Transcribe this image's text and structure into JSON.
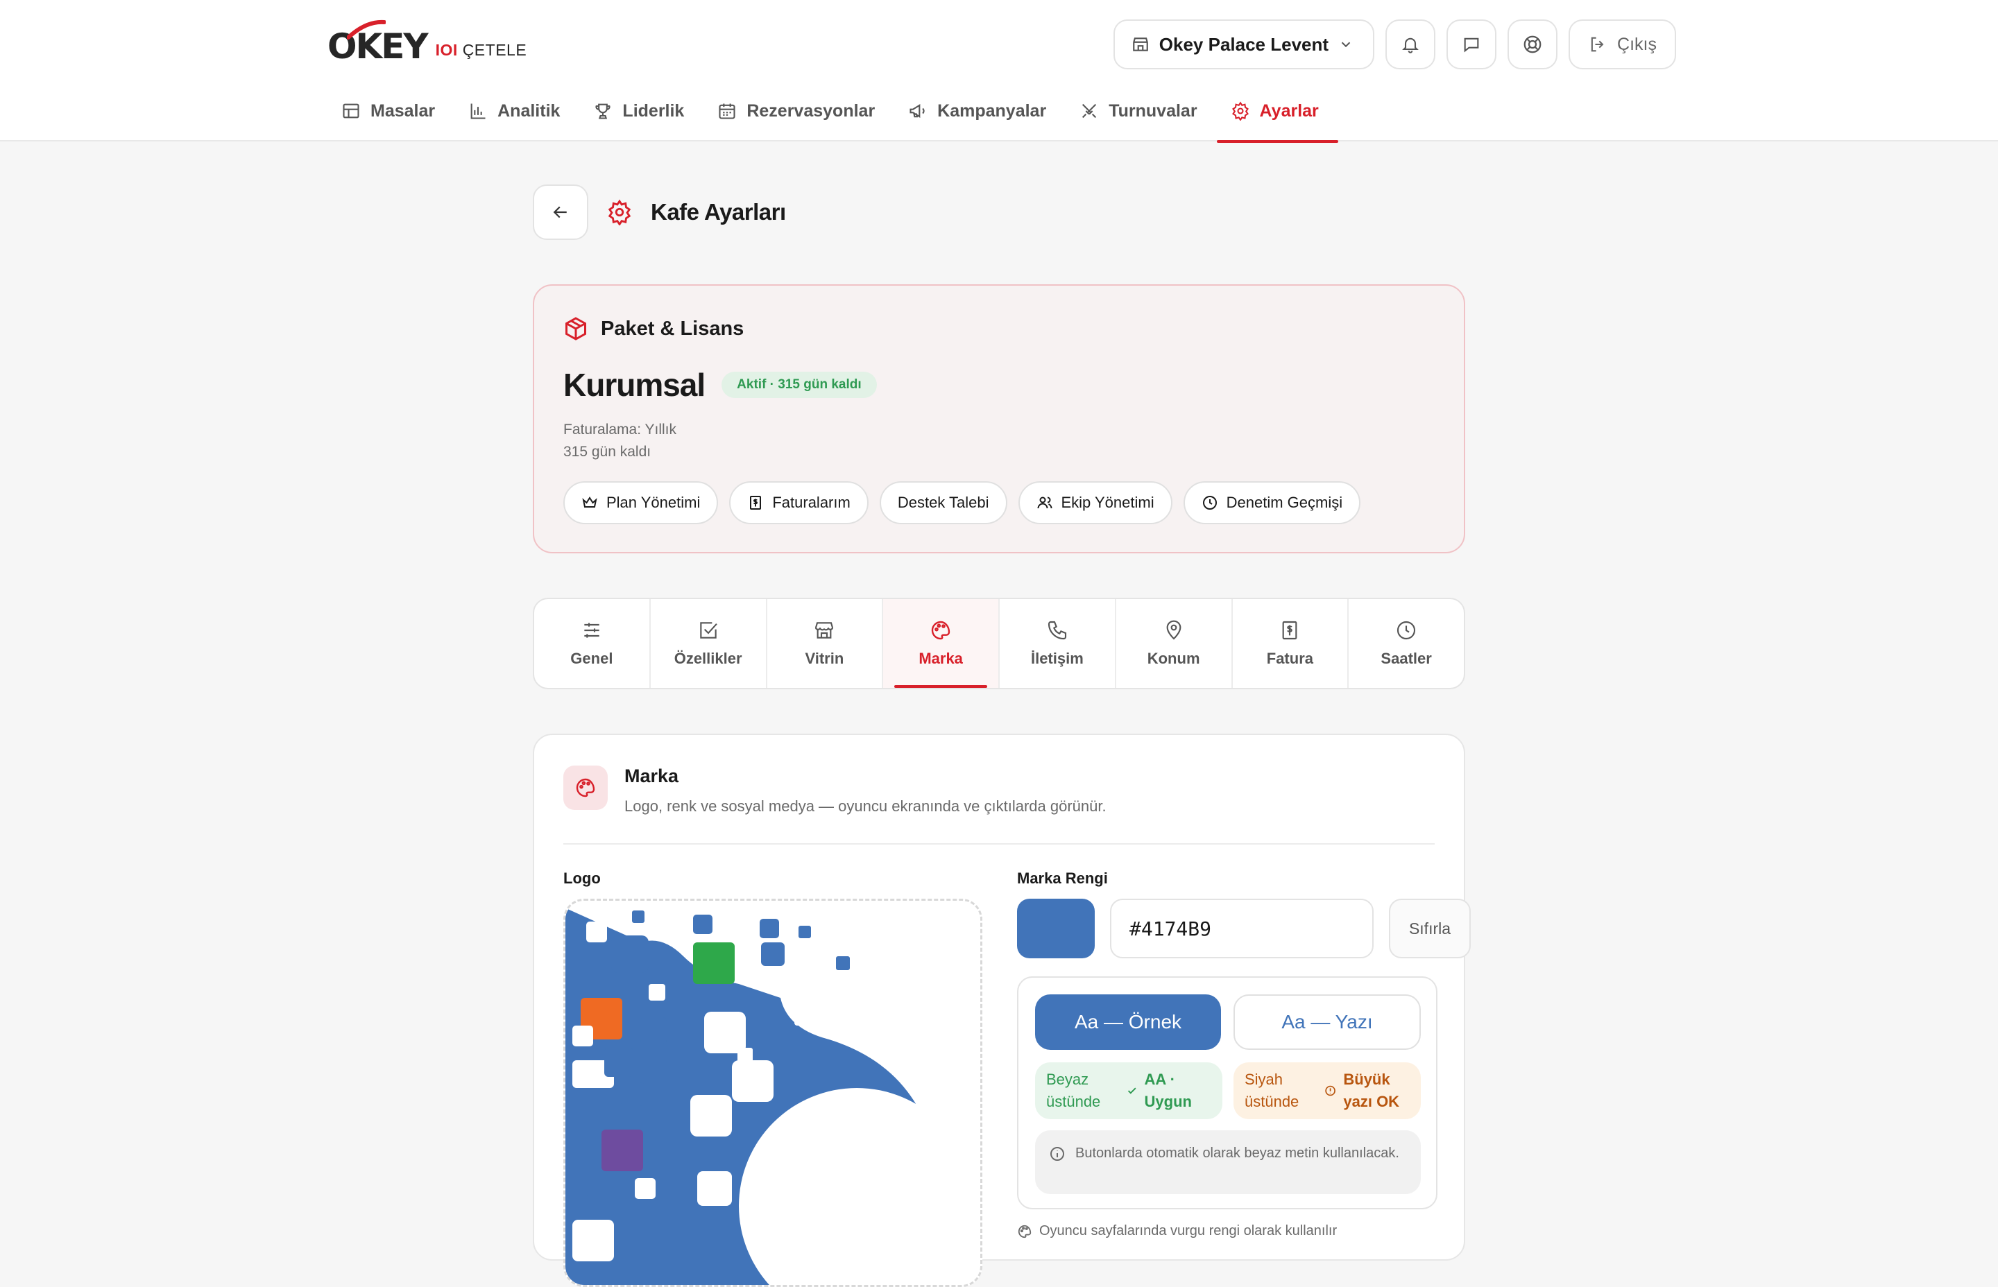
{
  "header": {
    "logo_main_1": "O",
    "logo_main_2": "KEY",
    "logo_sub_mark": "IOI",
    "logo_sub_text": "ÇETELE",
    "venue": "Okey Palace Levent",
    "logout_label": "Çıkış"
  },
  "nav": {
    "items": [
      {
        "label": "Masalar",
        "icon": "table-icon"
      },
      {
        "label": "Analitik",
        "icon": "bar-chart-icon"
      },
      {
        "label": "Liderlik",
        "icon": "trophy-icon"
      },
      {
        "label": "Rezervasyonlar",
        "icon": "calendar-icon"
      },
      {
        "label": "Kampanyalar",
        "icon": "megaphone-icon"
      },
      {
        "label": "Turnuvalar",
        "icon": "swords-icon"
      },
      {
        "label": "Ayarlar",
        "icon": "gear-icon"
      }
    ],
    "active": "Ayarlar"
  },
  "page": {
    "title": "Kafe Ayarları"
  },
  "license": {
    "heading": "Paket & Lisans",
    "plan": "Kurumsal",
    "status": "Aktif · 315 gün kaldı",
    "billing": "Faturalama: Yıllık",
    "remaining": "315 gün kaldı",
    "actions": [
      {
        "label": "Plan Yönetimi",
        "icon": "crown-icon"
      },
      {
        "label": "Faturalarım",
        "icon": "invoice-icon"
      },
      {
        "label": "Destek Talebi",
        "icon": ""
      },
      {
        "label": "Ekip Yönetimi",
        "icon": "users-icon"
      },
      {
        "label": "Denetim Geçmişi",
        "icon": "clock-icon"
      }
    ]
  },
  "tabs": {
    "items": [
      {
        "label": "Genel",
        "icon": "sliders-icon"
      },
      {
        "label": "Özellikler",
        "icon": "checkbox-icon"
      },
      {
        "label": "Vitrin",
        "icon": "store-icon"
      },
      {
        "label": "Marka",
        "icon": "palette-icon"
      },
      {
        "label": "İletişim",
        "icon": "phone-icon"
      },
      {
        "label": "Konum",
        "icon": "map-pin-icon"
      },
      {
        "label": "Fatura",
        "icon": "invoice-icon"
      },
      {
        "label": "Saatler",
        "icon": "clock-icon"
      }
    ],
    "active": "Marka"
  },
  "brand": {
    "title": "Marka",
    "subtitle": "Logo, renk ve sosyal medya — oyuncu ekranında ve çıktılarda görünür.",
    "logo_label": "Logo",
    "color_label": "Marka Rengi",
    "color_value": "#4174B9",
    "reset_label": "Sıfırla",
    "preview_fill_label": "Aa — Örnek",
    "preview_outline_label": "Aa — Yazı",
    "contrast_white_label": "Beyaz üstünde",
    "contrast_white_result": "AA · Uygun",
    "contrast_black_label": "Siyah üstünde",
    "contrast_black_result": "Büyük yazı OK",
    "info_text": "Butonlarda otomatik olarak beyaz metin kullanılacak.",
    "hint_text": "Oyuncu sayfalarında vurgu rengi olarak kullanılır"
  },
  "colors": {
    "accent": "#d8202a",
    "brand": "#4174B9",
    "logo_green": "#2ea84a",
    "logo_orange": "#ef6a23",
    "logo_purple": "#6e4c9f"
  }
}
